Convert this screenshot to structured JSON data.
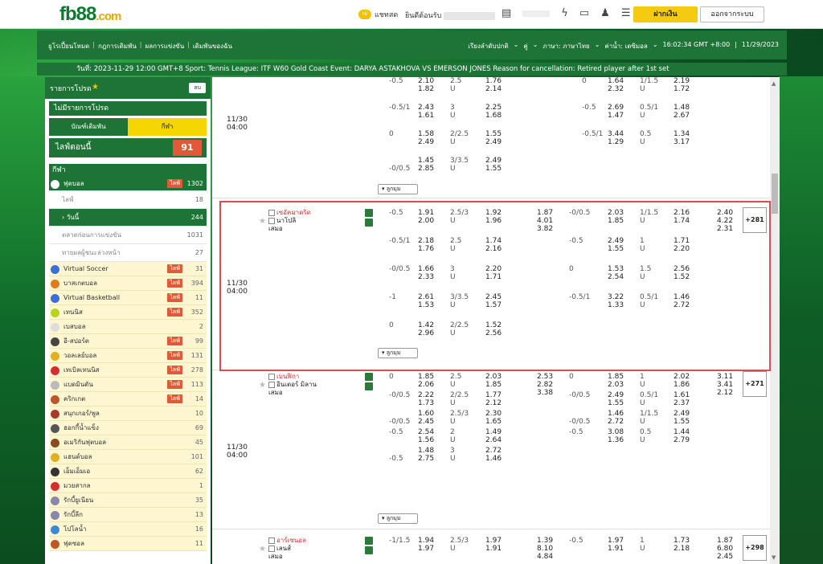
{
  "brand": {
    "logo_main": "fb88",
    "logo_suffix": ".com"
  },
  "topbar": {
    "chat_badge": "Hi",
    "chat": "แชทสด",
    "welcome": "ยินดีต้อนรับ",
    "deposit": "ฝากเงิน",
    "logout": "ออกจากระบบ"
  },
  "nav": {
    "links": [
      "ยูโรเปี้ยนโหมด",
      "กฎการเดิมพัน",
      "ผลการแข่งขัน",
      "เดิมพันของฉัน"
    ],
    "sort": "เรียงลำดับปกติ",
    "odds_type": "คู่",
    "language": "ภาษา: ภาษาไทย",
    "odds_format": "ค่าน้ำ: เดซิมอล",
    "clock": "16:02:34 GMT +8:00",
    "date": "11/29/2023"
  },
  "ticker": "วันที่: 2023-11-29 12:00 GMT+8 Sport: Tennis League: ITF W60 Gold Coast Event: DARYA ASTAKHOVA VS EMERSON JONES Reason for cancellation: Retired player after 1st set",
  "sidebar": {
    "favorites_title": "รายการโปรด",
    "clear": "ลบ",
    "no_favorites": "ไม่มีรายการโปรด",
    "tab_bets": "บัณฑ์เดิมพัน",
    "tab_sports": "กีฬา",
    "live_now": "ไลฟ์ตอนนี้",
    "live_count": "91",
    "sports_title": "กีฬา",
    "football": {
      "label": "ฟุตบอล",
      "live": "ไลฟ์",
      "count": "1302"
    },
    "sub": [
      {
        "label": "ไลฟ์",
        "count": "18"
      },
      {
        "label": "วันนี้",
        "count": "244"
      },
      {
        "label": "ตลาดก่อนการแข่งขัน",
        "count": "1031"
      },
      {
        "label": "ทายผลผู้ชนะล่วงหน้า",
        "count": "27"
      }
    ],
    "sports": [
      {
        "label": "Virtual Soccer",
        "live": "ไลฟ์",
        "count": "31",
        "color": "#3a6fd8"
      },
      {
        "label": "บาสเกตบอล",
        "live": "ไลฟ์",
        "count": "394",
        "color": "#e07a1e"
      },
      {
        "label": "Virtual Basketball",
        "live": "ไลฟ์",
        "count": "11",
        "color": "#3a6fd8"
      },
      {
        "label": "เทนนิส",
        "live": "ไลฟ์",
        "count": "352",
        "color": "#b7d421"
      },
      {
        "label": "เบสบอล",
        "live": "",
        "count": "2",
        "color": "#dddddd"
      },
      {
        "label": "อี-สปอร์ต",
        "live": "ไลฟ์",
        "count": "99",
        "color": "#444444"
      },
      {
        "label": "วอลเลย์บอล",
        "live": "ไลฟ์",
        "count": "131",
        "color": "#e0b020"
      },
      {
        "label": "เทเบิลเทนนิส",
        "live": "ไลฟ์",
        "count": "278",
        "color": "#d32f2f"
      },
      {
        "label": "แบดมินตัน",
        "live": "ไลฟ์",
        "count": "113",
        "color": "#bbbbbb"
      },
      {
        "label": "คริกเกต",
        "live": "ไลฟ์",
        "count": "14",
        "color": "#c0542a"
      },
      {
        "label": "สนุกเกอร์/พูล",
        "live": "",
        "count": "10",
        "color": "#a83a2a"
      },
      {
        "label": "ฮอกกี้น้ำแข็ง",
        "live": "",
        "count": "69",
        "color": "#555555"
      },
      {
        "label": "อเมริกันฟุตบอล",
        "live": "",
        "count": "45",
        "color": "#8a4a22"
      },
      {
        "label": "แฮนด์บอล",
        "live": "",
        "count": "101",
        "color": "#e0b020"
      },
      {
        "label": "เอ็มเอ็มเอ",
        "live": "",
        "count": "62",
        "color": "#333333"
      },
      {
        "label": "มวยสากล",
        "live": "",
        "count": "1",
        "color": "#d32f2f"
      },
      {
        "label": "รักบี้ยูเนียน",
        "live": "",
        "count": "35",
        "color": "#8888aa"
      },
      {
        "label": "รักบี้ลีก",
        "live": "",
        "count": "13",
        "color": "#8888aa"
      },
      {
        "label": "โปโลน้ำ",
        "live": "",
        "count": "16",
        "color": "#3a8ad8"
      },
      {
        "label": "ฟุตซอล",
        "live": "",
        "count": "11",
        "color": "#c0542a"
      }
    ]
  },
  "more_label": "ลูกมุม",
  "draw": "เสมอ",
  "u": "U",
  "matches": [
    {
      "date": "11/30",
      "time": "04:00",
      "rows": [
        [
          "-0.5",
          "2.10",
          "2.5",
          "1.76",
          "",
          "",
          "0",
          "1.64",
          "1/1.5",
          "2.19"
        ],
        [
          "",
          "1.82",
          "U",
          "2.14",
          "",
          "",
          "",
          "2.32",
          "U",
          "1.72"
        ],
        [
          "-0.5/1",
          "2.43",
          "3",
          "2.25",
          "",
          "",
          "-0.5",
          "2.69",
          "0.5/1",
          "1.48"
        ],
        [
          "",
          "1.61",
          "U",
          "1.68",
          "",
          "",
          "",
          "1.47",
          "U",
          "2.67"
        ],
        [
          "0",
          "1.58",
          "2/2.5",
          "1.55",
          "",
          "",
          "-0.5/1",
          "3.44",
          "0.5",
          "1.34"
        ],
        [
          "",
          "2.49",
          "U",
          "2.49",
          "",
          "",
          "",
          "1.29",
          "U",
          "3.17"
        ],
        [
          "",
          "1.45",
          "3/3.5",
          "2.49",
          "",
          "",
          "",
          "",
          "",
          ""
        ],
        [
          "-0/0.5",
          "2.85",
          "U",
          "1.55",
          "",
          "",
          "",
          "",
          "",
          ""
        ]
      ]
    },
    {
      "date": "11/30",
      "time": "04:00",
      "home": "เซอัคมาดริด",
      "away": "นาโปลิ",
      "plus": "+281",
      "x12": [
        "1.87",
        "4.01",
        "3.82"
      ],
      "x12_ht": [
        "2.40",
        "4.22",
        "2.31"
      ],
      "rows": [
        [
          "-0.5",
          "1.91",
          "2.5/3",
          "1.92",
          "-0/0.5",
          "2.03",
          "1/1.5",
          "2.16"
        ],
        [
          "",
          "2.00",
          "U",
          "1.96",
          "",
          "1.85",
          "U",
          "1.74"
        ],
        [
          "-0.5/1",
          "2.18",
          "2.5",
          "1.74",
          "-0.5",
          "2.49",
          "1",
          "1.71"
        ],
        [
          "",
          "1.76",
          "U",
          "2.16",
          "",
          "1.55",
          "U",
          "2.20"
        ],
        [
          "-0/0.5",
          "1.66",
          "3",
          "2.20",
          "0",
          "1.53",
          "1.5",
          "2.56"
        ],
        [
          "",
          "2.33",
          "U",
          "1.71",
          "",
          "2.54",
          "U",
          "1.52"
        ],
        [
          "-1",
          "2.61",
          "3/3.5",
          "2.45",
          "-0.5/1",
          "3.22",
          "0.5/1",
          "1.46"
        ],
        [
          "",
          "1.53",
          "U",
          "1.57",
          "",
          "1.33",
          "U",
          "2.72"
        ],
        [
          "0",
          "1.42",
          "2/2.5",
          "1.52",
          "",
          "",
          "",
          ""
        ],
        [
          "",
          "2.96",
          "U",
          "2.56",
          "",
          "",
          "",
          ""
        ]
      ]
    },
    {
      "date": "11/30",
      "time": "04:00",
      "home": "เบนฟิกา",
      "away": "อินเตอร์ มิลาน",
      "plus": "+271",
      "x12": [
        "2.53",
        "2.82",
        "3.38"
      ],
      "x12_ht": [
        "3.11",
        "3.41",
        "2.12"
      ],
      "rows": [
        [
          "0",
          "1.85",
          "2.5",
          "2.03",
          "0",
          "1.85",
          "1",
          "2.02"
        ],
        [
          "",
          "2.06",
          "U",
          "1.85",
          "",
          "2.03",
          "U",
          "1.86"
        ],
        [
          "-0/0.5",
          "2.22",
          "2/2.5",
          "1.77",
          "-0/0.5",
          "2.49",
          "0.5/1",
          "1.61"
        ],
        [
          "",
          "1.73",
          "U",
          "2.12",
          "",
          "1.55",
          "U",
          "2.37"
        ],
        [
          "",
          "1.60",
          "2.5/3",
          "2.30",
          "",
          "1.46",
          "1/1.5",
          "2.49"
        ],
        [
          "-0/0.5",
          "2.45",
          "U",
          "1.65",
          "-0/0.5",
          "2.72",
          "U",
          "1.55"
        ],
        [
          "-0.5",
          "2.54",
          "2",
          "1.49",
          "-0.5",
          "3.08",
          "0.5",
          "1.44"
        ],
        [
          "",
          "1.56",
          "U",
          "2.64",
          "",
          "1.36",
          "U",
          "2.79"
        ],
        [
          "",
          "1.48",
          "3",
          "2.72",
          "",
          "",
          "",
          ""
        ],
        [
          "-0.5",
          "2.75",
          "U",
          "1.46",
          "",
          "",
          "",
          ""
        ]
      ]
    },
    {
      "date": "",
      "time": "",
      "home": "อาร์เซนอล",
      "away": "เลนส์",
      "plus": "+298",
      "x12": [
        "1.39",
        "8.10",
        "4.84"
      ],
      "x12_ht": [
        "1.87",
        "6.80",
        "2.45"
      ],
      "rows": [
        [
          "-1/1.5",
          "1.94",
          "2.5/3",
          "1.97",
          "-0.5",
          "1.97",
          "1",
          "1.73"
        ],
        [
          "",
          "1.97",
          "U",
          "1.91",
          "",
          "1.91",
          "U",
          "2.18"
        ]
      ]
    }
  ]
}
